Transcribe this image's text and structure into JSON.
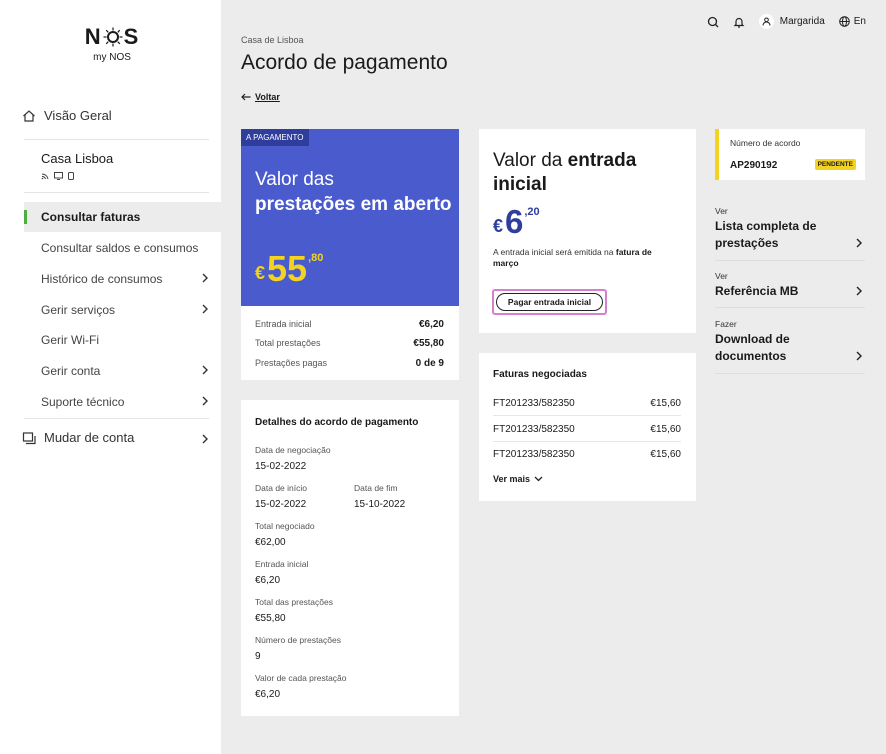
{
  "sidebar": {
    "brand": "N S",
    "brand_sub": "my NOS",
    "overview_label": "Visão Geral",
    "house_title": "Casa Lisboa",
    "menu": [
      {
        "label": "Consultar faturas"
      },
      {
        "label": "Consultar saldos e consumos"
      },
      {
        "label": "Histórico de consumos"
      },
      {
        "label": "Gerir serviços"
      },
      {
        "label": "Gerir Wi-Fi"
      },
      {
        "label": "Gerir conta"
      },
      {
        "label": "Suporte técnico"
      }
    ],
    "switch_account_label": "Mudar de conta"
  },
  "topbar": {
    "user_name": "Margarida",
    "language": "En"
  },
  "header": {
    "breadcrumb": "Casa de Lisboa",
    "title": "Acordo de pagamento",
    "back_label": "Voltar"
  },
  "installments": {
    "tag": "A PAGAMENTO",
    "title_light": "Valor das",
    "title_bold": "prestações em aberto",
    "currency": "€",
    "amount_int": "55",
    "amount_dec": ",80",
    "rows": [
      {
        "label": "Entrada inicial",
        "value": "€6,20"
      },
      {
        "label": "Total prestações",
        "value": "€55,80"
      },
      {
        "label": "Prestações pagas",
        "value": "0 de 9"
      }
    ]
  },
  "details": {
    "title": "Detalhes do acordo de pagamento",
    "negotiation_date": {
      "label": "Data de negociação",
      "value": "15-02-2022"
    },
    "start_date": {
      "label": "Data de início",
      "value": "15-02-2022"
    },
    "end_date": {
      "label": "Data de fim",
      "value": "15-10-2022"
    },
    "total_negotiated": {
      "label": "Total negociado",
      "value": "€62,00"
    },
    "initial_entry": {
      "label": "Entrada inicial",
      "value": "€6,20"
    },
    "total_installments": {
      "label": "Total das prestações",
      "value": "€55,80"
    },
    "installments_count": {
      "label": "Número de prestações",
      "value": "9"
    },
    "installment_value": {
      "label": "Valor de cada prestação",
      "value": "€6,20"
    }
  },
  "entry": {
    "title_light": "Valor da",
    "title_bold_1": "entrada",
    "title_bold_2": "inicial",
    "currency": "€",
    "amount_int": "6",
    "amount_dec": ",20",
    "note_text": "A entrada inicial será emitida na",
    "note_bold": "fatura de março",
    "pay_button": "Pagar entrada inicial"
  },
  "invoices": {
    "title": "Faturas negociadas",
    "rows": [
      {
        "id": "FT201233/582350",
        "amount": "€15,60"
      },
      {
        "id": "FT201233/582350",
        "amount": "€15,60"
      },
      {
        "id": "FT201233/582350",
        "amount": "€15,60"
      }
    ],
    "more_label": "Ver mais"
  },
  "agreement": {
    "label": "Número de acordo",
    "number": "AP290192",
    "status": "PENDENTE"
  },
  "links": [
    {
      "small": "Ver",
      "big": "Lista completa de prestações"
    },
    {
      "small": "Ver",
      "big": "Referência MB"
    },
    {
      "small": "Fazer",
      "big": "Download de documentos"
    }
  ],
  "colors": {
    "primary_blue": "#4a5ccd",
    "dark_blue": "#2f3d9c",
    "accent_yellow": "#f4d320",
    "active_green": "#4caf3f"
  }
}
